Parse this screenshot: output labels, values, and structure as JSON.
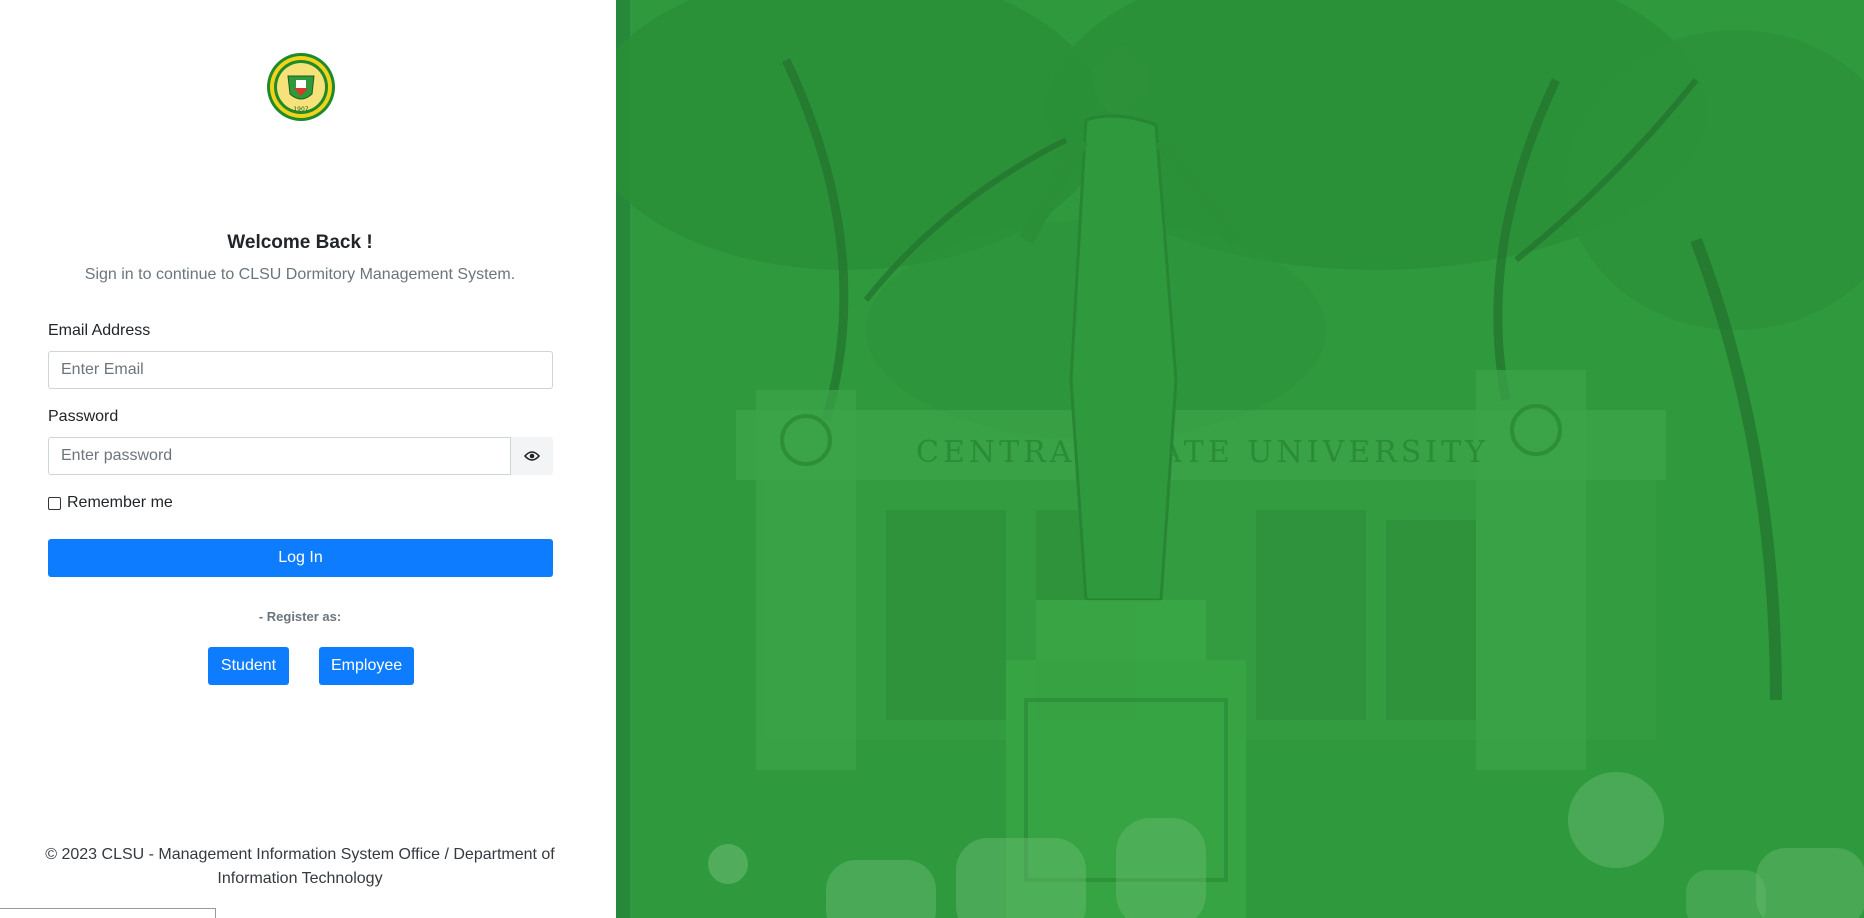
{
  "brand": {
    "logo_icon": "clsu-seal-logo",
    "seal_year": "1907"
  },
  "auth": {
    "title": "Welcome Back !",
    "subtitle": "Sign in to continue to CLSU Dormitory Management System.",
    "email_label": "Email Address",
    "email_placeholder": "Enter Email",
    "email_value": "",
    "password_label": "Password",
    "password_placeholder": "Enter password",
    "password_value": "",
    "password_toggle_icon": "eye-icon",
    "remember_label": "Remember me",
    "remember_checked": false,
    "login_label": "Log In",
    "register_label": "- Register as:",
    "register_student_label": "Student",
    "register_employee_label": "Employee"
  },
  "footer": {
    "text": "© 2023 CLSU - Management Information System Office / Department of Information Technology"
  },
  "hero": {
    "sign_text": "CENTRAL   STATE UNIVERSITY",
    "overlay_color": "#2f9a3d"
  },
  "colors": {
    "primary": "#0d7cff",
    "green_overlay": "#2f9a3d",
    "muted_text": "#6c757d"
  }
}
